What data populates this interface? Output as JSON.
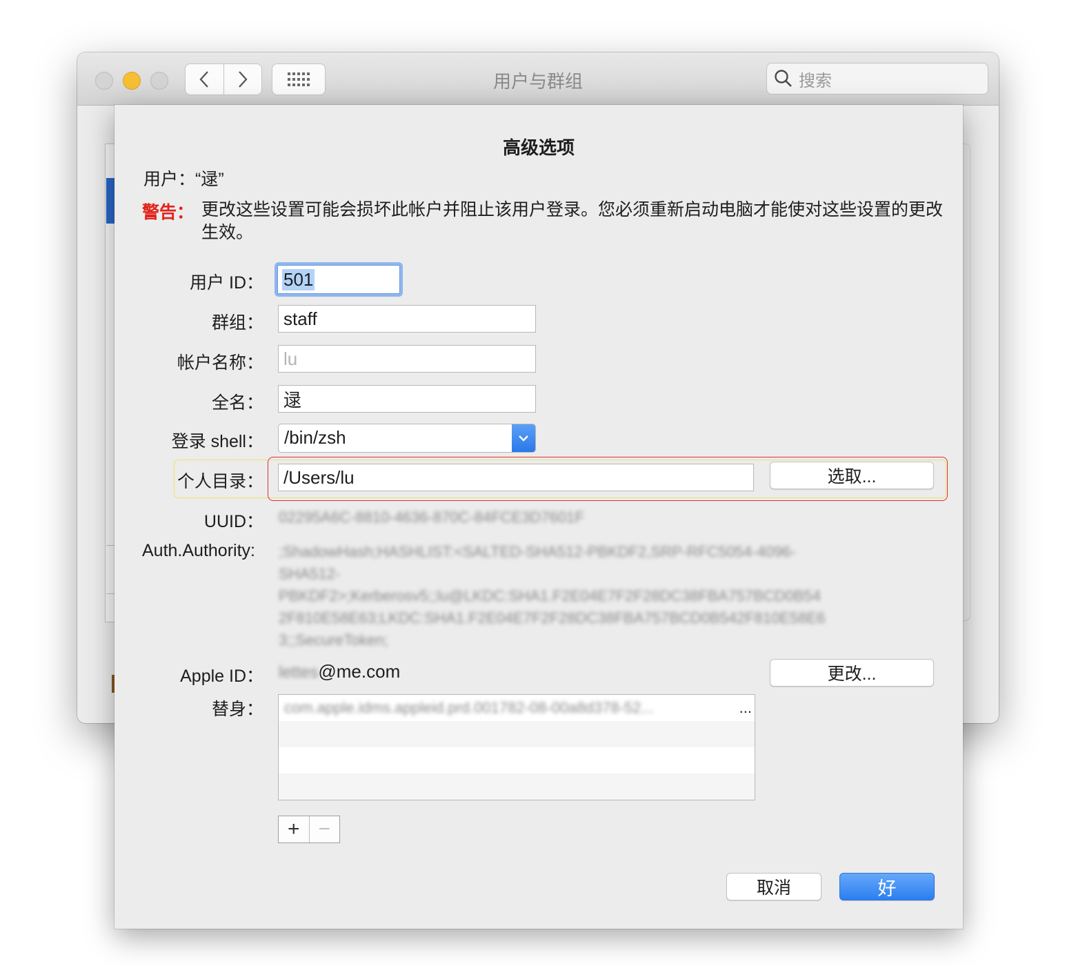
{
  "window": {
    "title": "用户与群组",
    "search_placeholder": "搜索"
  },
  "sheet": {
    "title": "高级选项",
    "user_line": "用户：“逯”",
    "warning_label": "警告：",
    "warning_text": "更改这些设置可能会损坏此帐户并阻止该用户登录。您必须重新启动电脑才能使对这些设置的更改生效。",
    "fields": {
      "user_id": {
        "label": "用户 ID：",
        "value": "501"
      },
      "group": {
        "label": "群组：",
        "value": "staff"
      },
      "account_name": {
        "label": "帐户名称：",
        "value": "lu"
      },
      "full_name": {
        "label": "全名：",
        "value": "逯"
      },
      "login_shell": {
        "label": "登录 shell：",
        "value": "/bin/zsh"
      },
      "home_dir": {
        "label": "个人目录：",
        "value": "/Users/lu",
        "button": "选取..."
      },
      "uuid": {
        "label": "UUID：",
        "value": "02295A6C-8810-4636-870C-84FCE3D7601F"
      },
      "auth_authority": {
        "label": "Auth.Authority:",
        "lines": [
          ";ShadowHash;HASHLIST:<SALTED-SHA512-PBKDF2,SRP-RFC5054-4096-",
          "SHA512-",
          "PBKDF2>;Kerberosv5;;lu@LKDC:SHA1.F2E04E7F2F28DC38FBA757BCD0B54",
          "2F810E58E63;LKDC:SHA1.F2E04E7F2F28DC38FBA757BCD0B542F810E58E6",
          "3;;SecureToken;"
        ]
      },
      "apple_id": {
        "label": "Apple ID：",
        "prefix": "lettes",
        "suffix": "@me.com",
        "button": "更改..."
      },
      "aliases": {
        "label": "替身：",
        "items": [
          "com.apple.idms.appleid.prd.001782-08-00a8d378-52..."
        ]
      }
    },
    "list_buttons": {
      "add": "+",
      "remove": "−"
    },
    "cancel": "取消",
    "ok": "好"
  }
}
